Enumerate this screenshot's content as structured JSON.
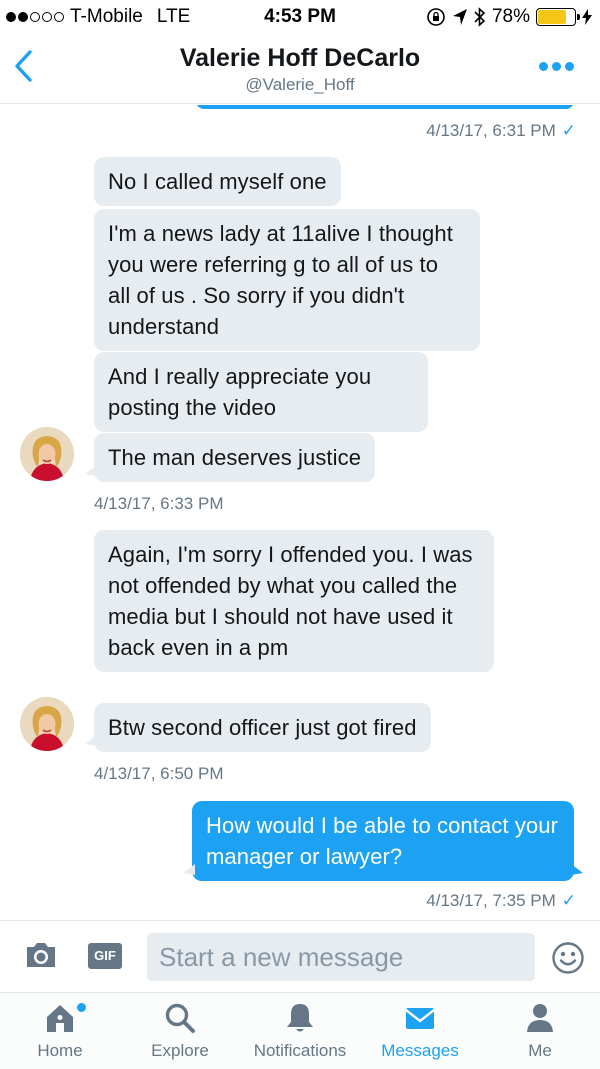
{
  "status_bar": {
    "carrier": "T-Mobile",
    "network": "LTE",
    "time": "4:53 PM",
    "battery_percent": "78%",
    "battery_level": 0.78,
    "signal_bars_filled": 2,
    "signal_bars_total": 5
  },
  "header": {
    "name": "Valerie Hoff DeCarlo",
    "handle": "@Valerie_Hoff"
  },
  "conversation": {
    "ts_top": "4/13/17, 6:31 PM",
    "msg1": "No I called myself one",
    "msg2": "I'm a news lady at 11alive I thought you were referring g to all of us to all of us . So sorry if you didn't understand",
    "msg3": "And I really appreciate you posting the video",
    "msg4": "The man deserves justice",
    "ts_group1": "4/13/17, 6:33 PM",
    "msg5": "Again, I'm sorry I offended you. I was not offended by what you called the media but I should not have used it back even in a pm",
    "msg6": "Btw second officer just got fired",
    "ts_group2": "4/13/17, 6:50 PM",
    "msg7": "How would I be able to contact your manager or lawyer?",
    "ts_sent": "4/13/17, 7:35 PM"
  },
  "composer": {
    "placeholder": "Start a new message",
    "gif_label": "GIF"
  },
  "tabs": {
    "home": "Home",
    "explore": "Explore",
    "notifications": "Notifications",
    "messages": "Messages",
    "me": "Me"
  },
  "colors": {
    "accent": "#1da1f2",
    "bubble_in": "#e6ecf0",
    "secondary_text": "#657786",
    "battery": "#f5c518"
  },
  "icons": {
    "back": "chevron-left-icon",
    "more": "more-dots-icon",
    "camera": "camera-icon",
    "gif": "gif-icon",
    "emoji": "emoji-icon",
    "home": "home-icon",
    "explore": "search-icon",
    "notifications": "bell-icon",
    "messages": "envelope-icon",
    "me": "person-icon"
  }
}
